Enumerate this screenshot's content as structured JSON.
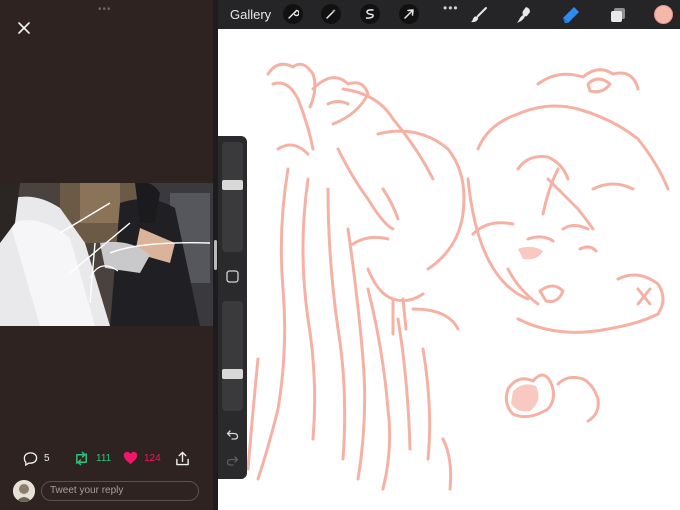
{
  "twitter": {
    "reply_count": "5",
    "retweet_count": "111",
    "like_count": "124",
    "reply_placeholder": "Tweet your reply",
    "colors": {
      "retweet": "#2ec27e",
      "like": "#f0166a",
      "bg": "#2f2321"
    }
  },
  "procreate": {
    "gallery_label": "Gallery",
    "toolbar_icons": [
      "wrench-icon",
      "magic-wand-icon",
      "selection-icon",
      "transform-arrow-icon"
    ],
    "right_icons": [
      "brush-icon",
      "smudge-icon",
      "eraser-icon",
      "layers-icon"
    ],
    "active_tool": "eraser-icon",
    "current_color": "#f5b7aa",
    "sidebar": {
      "brush_size_level": 0.62,
      "opacity_level": 0.32
    }
  }
}
